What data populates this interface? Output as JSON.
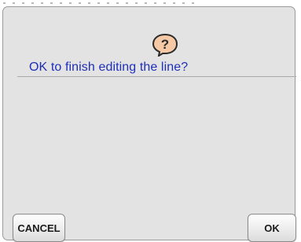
{
  "dialog": {
    "icon": "question-bubble-icon",
    "message": "OK to finish editing the line?",
    "cancel_label": "CANCEL",
    "ok_label": "OK"
  },
  "colors": {
    "message": "#1e2fb8",
    "dialog_background": "#e3e3e3",
    "icon_fill": "#f6c9a6"
  }
}
